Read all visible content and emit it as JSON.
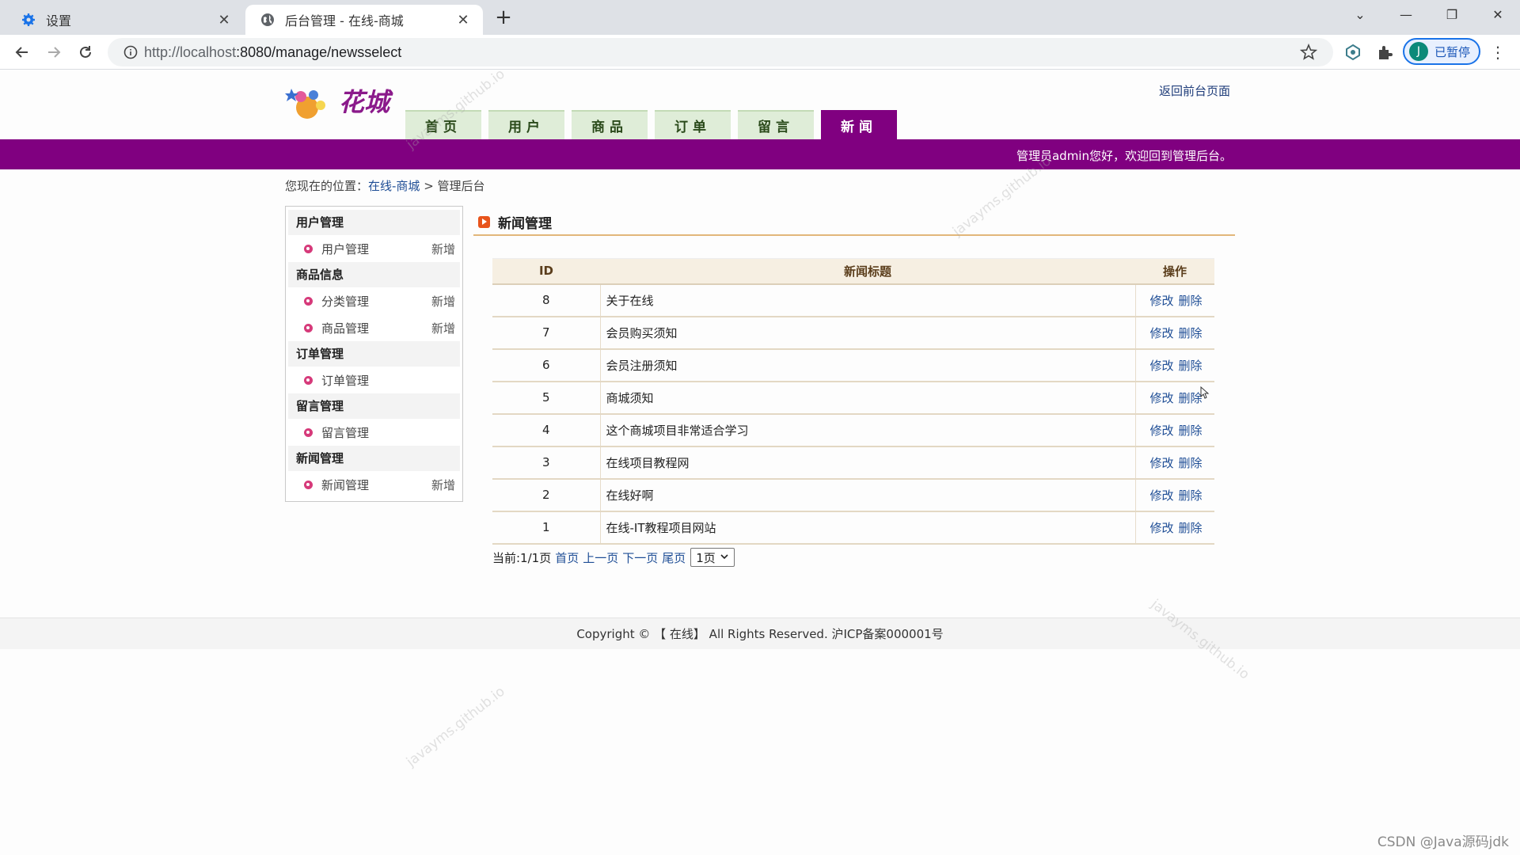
{
  "browser": {
    "tabs": [
      {
        "label": "设置",
        "icon": "gear-icon",
        "active": false
      },
      {
        "label": "后台管理 - 在线-商城",
        "icon": "globe-icon",
        "active": true
      }
    ],
    "url_host": "http://localhost",
    "url_rest": ":8080/manage/newsselect",
    "profile_initial": "J",
    "profile_label": "已暂停"
  },
  "header": {
    "logo_text": "花城",
    "back_link": "返回前台页面",
    "nav": [
      {
        "label": "首页",
        "active": false
      },
      {
        "label": "用户",
        "active": false
      },
      {
        "label": "商品",
        "active": false
      },
      {
        "label": "订单",
        "active": false
      },
      {
        "label": "留言",
        "active": false
      },
      {
        "label": "新闻",
        "active": true
      }
    ],
    "welcome": "管理员admin您好，欢迎回到管理后台。"
  },
  "breadcrumb": {
    "prefix": "您现在的位置：",
    "home": "在线-商城",
    "sep": " > ",
    "current": "管理后台"
  },
  "sidebar": {
    "groups": [
      {
        "title": "用户管理",
        "items": [
          {
            "label": "用户管理",
            "add": "新增"
          }
        ]
      },
      {
        "title": "商品信息",
        "items": [
          {
            "label": "分类管理",
            "add": "新增"
          },
          {
            "label": "商品管理",
            "add": "新增"
          }
        ]
      },
      {
        "title": "订单管理",
        "items": [
          {
            "label": "订单管理",
            "add": ""
          }
        ]
      },
      {
        "title": "留言管理",
        "items": [
          {
            "label": "留言管理",
            "add": ""
          }
        ]
      },
      {
        "title": "新闻管理",
        "items": [
          {
            "label": "新闻管理",
            "add": "新增"
          }
        ]
      }
    ]
  },
  "main": {
    "title": "新闻管理",
    "columns": [
      "ID",
      "新闻标题",
      "操作"
    ],
    "edit_label": "修改",
    "delete_label": "删除",
    "rows": [
      {
        "id": "8",
        "title": "关于在线"
      },
      {
        "id": "7",
        "title": "会员购买须知"
      },
      {
        "id": "6",
        "title": "会员注册须知"
      },
      {
        "id": "5",
        "title": "商城须知"
      },
      {
        "id": "4",
        "title": "这个商城项目非常适合学习"
      },
      {
        "id": "3",
        "title": "在线项目教程网"
      },
      {
        "id": "2",
        "title": "在线好啊"
      },
      {
        "id": "1",
        "title": "在线-IT教程项目网站"
      }
    ]
  },
  "pager": {
    "status": "当前:1/1页",
    "first": "首页",
    "prev": "上一页",
    "next": "下一页",
    "last": "尾页",
    "select_value": "1页"
  },
  "footer": {
    "text": "Copyright © 【 在线】 All Rights Reserved. 沪ICP备案000001号"
  },
  "watermark": "javayms.github.io",
  "credit": "CSDN @Java源码jdk",
  "colors": {
    "brand_purple": "#800080",
    "nav_tab_green": "#dfedd8",
    "table_header_bg": "#f6efe2",
    "link_blue": "#1f4e96"
  }
}
